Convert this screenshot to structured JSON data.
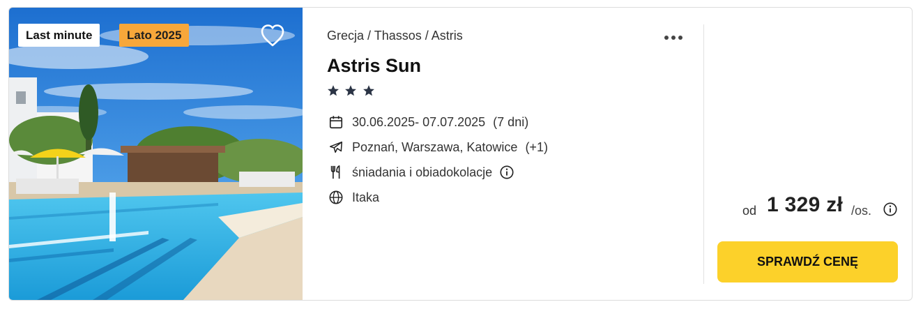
{
  "photo": {
    "badge_last_minute": "Last minute",
    "badge_season": "Lato 2025",
    "favorite_icon": "heart-outline-icon"
  },
  "hotel": {
    "breadcrumb": "Grecja / Thassos / Astris",
    "name": "Astris Sun",
    "stars": 3,
    "dates": "30.06.2025- 07.07.2025",
    "duration": "(7 dni)",
    "departures": "Poznań, Warszawa, Katowice",
    "departures_more": "(+1)",
    "board": "śniadania i obiadokolacje",
    "operator": "Itaka",
    "more_options_icon": "more-horizontal-icon"
  },
  "price": {
    "from_label": "od",
    "amount": "1 329 zł",
    "unit": "/os.",
    "cta_label": "SPRAWDŹ CENĘ"
  },
  "colors": {
    "season_badge": "#f7a73a",
    "cta_background": "#fcd12a",
    "star": "#2b3445"
  }
}
